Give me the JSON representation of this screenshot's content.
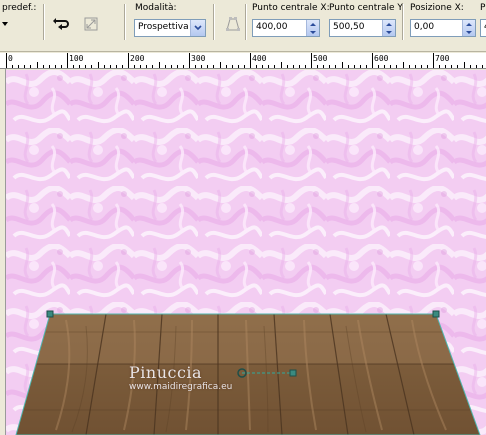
{
  "toolbar": {
    "preset_label": "predef.:",
    "mode_label": "Modalità:",
    "mode_value": "Prospettiva",
    "center_x_label": "Punto centrale X:",
    "center_x_value": "400,00",
    "center_y_label": "Punto centrale Y:",
    "center_y_value": "500,50",
    "position_x_label": "Posizione X:",
    "position_x_value": "0,00",
    "icons": [
      "rotate-arrow-icon",
      "reset-transform-icon",
      "perspective-box-icon"
    ]
  },
  "ruler": {
    "labels": [
      "0",
      "100",
      "200",
      "300",
      "400",
      "500",
      "600",
      "700"
    ]
  },
  "canvas": {
    "background": "pink-marble-texture",
    "floor": "wood-parquet-perspective",
    "handle_color": "#3a8a80",
    "watermark_title": "Pinuccia",
    "watermark_url": "www.maidiregrafica.eu"
  }
}
